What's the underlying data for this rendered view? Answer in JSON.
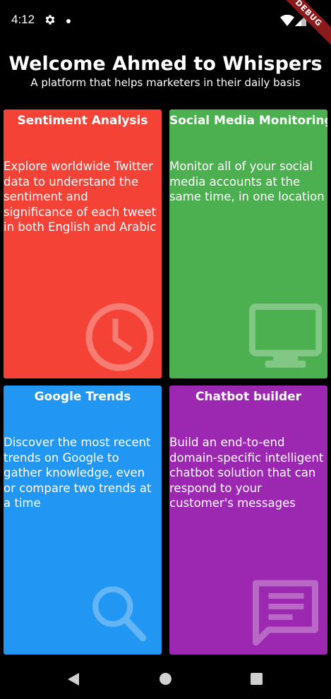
{
  "status_bar": {
    "time": "4:12",
    "debug_label": "DEBUG"
  },
  "header": {
    "title": "Welcome Ahmed to Whispers",
    "subtitle": "A platform that helps marketers in their daily basis"
  },
  "cards": [
    {
      "title": "Sentiment Analysis",
      "description": "Explore worldwide Twitter data to understand the sentiment and significance of each tweet in both English and Arabic",
      "color": "#f44336",
      "icon": "clock-icon"
    },
    {
      "title": "Social Media Monitoring",
      "description": "Monitor all of your social media accounts at the same time, in one location",
      "color": "#4caf50",
      "icon": "monitor-icon"
    },
    {
      "title": "Google Trends",
      "description": "Discover the most recent trends on Google to gather knowledge, even or compare two trends at a time",
      "color": "#2196f3",
      "icon": "search-icon"
    },
    {
      "title": "Chatbot builder",
      "description": "Build an end-to-end domain-specific intelligent chatbot solution that can respond to your customer's messages",
      "color": "#9c27b0",
      "icon": "chat-message-icon"
    }
  ],
  "nav_bar": {
    "icons": [
      "back-icon",
      "home-icon",
      "recents-icon"
    ]
  }
}
